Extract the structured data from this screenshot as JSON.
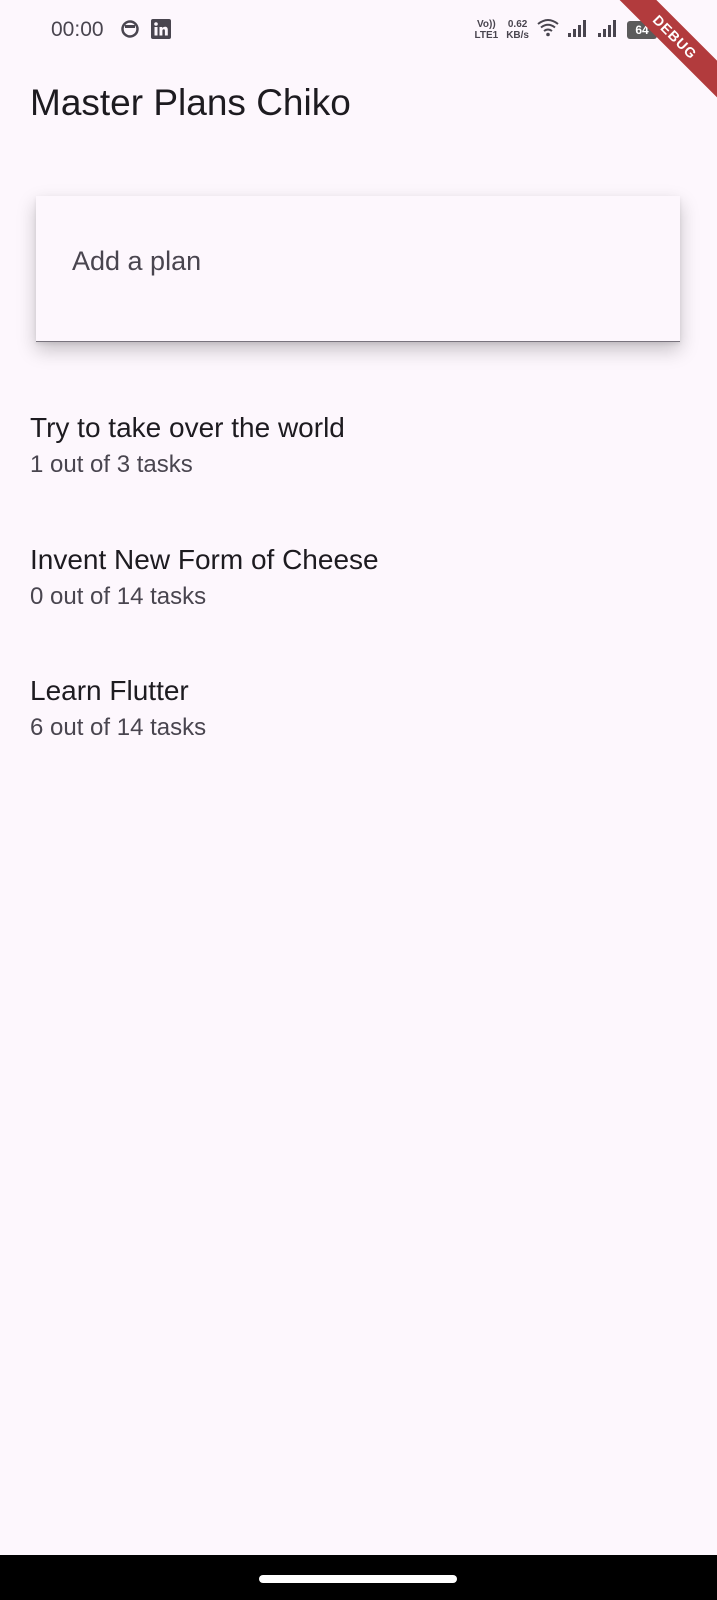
{
  "status_bar": {
    "time": "00:00",
    "icons_left": [
      "notification-circle-icon",
      "linkedin-icon"
    ],
    "volte_top": "Vo))",
    "volte_bottom": "LTE1",
    "net_speed_value": "0.62",
    "net_speed_unit": "KB/s",
    "icons_right": [
      "wifi-icon",
      "signal-icon",
      "signal-icon"
    ],
    "battery": "64"
  },
  "debug_banner": "DEBUG",
  "app_bar": {
    "title": "Master Plans Chiko"
  },
  "input": {
    "placeholder": "Add a plan",
    "value": ""
  },
  "plans": [
    {
      "title": "Try to take over the world",
      "subtitle": "1 out of 3 tasks"
    },
    {
      "title": "Invent New Form of Cheese",
      "subtitle": "0 out of 14 tasks"
    },
    {
      "title": "Learn Flutter",
      "subtitle": "6 out of 14 tasks"
    }
  ],
  "colors": {
    "background": "#fdf7fd",
    "text_primary": "#1d1b20",
    "text_secondary": "#49454f",
    "debug_ribbon": "#b23b3d"
  }
}
